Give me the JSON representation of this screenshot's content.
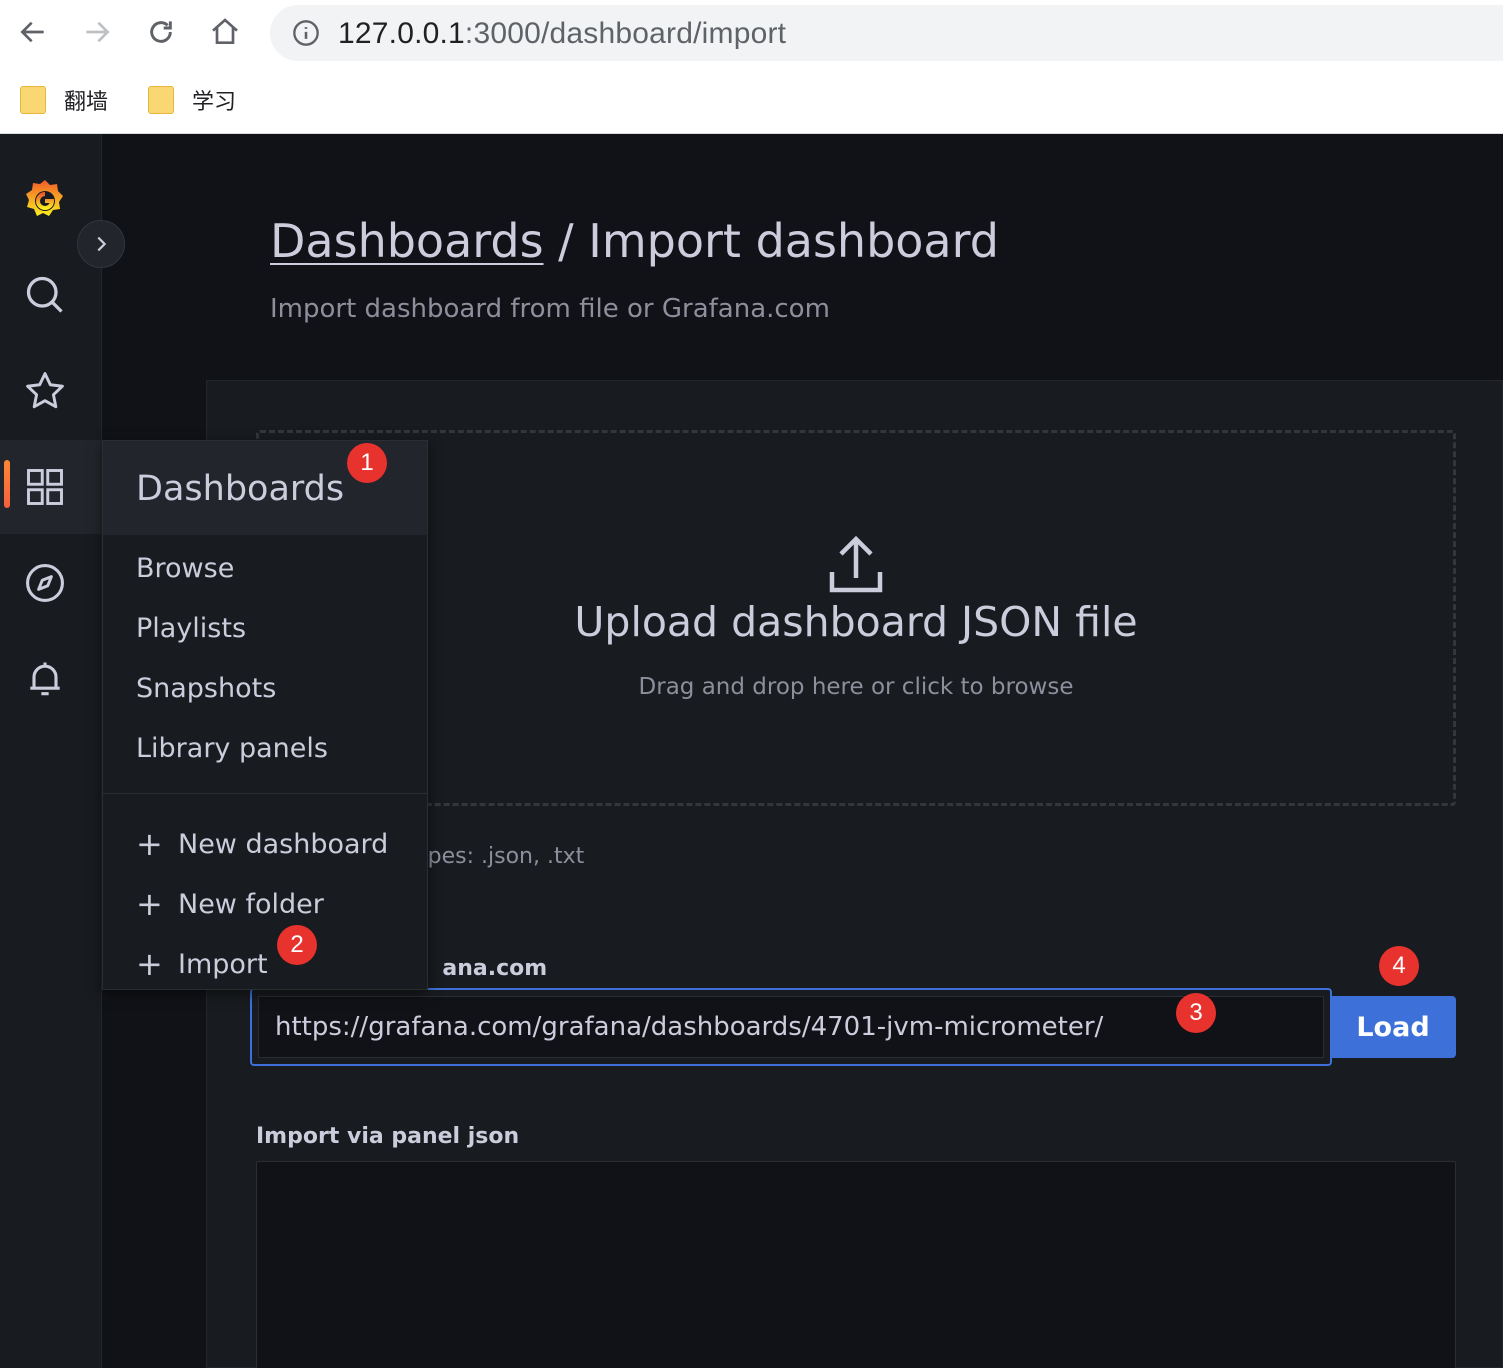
{
  "browser": {
    "url_host": "127.0.0.1",
    "url_path": ":3000/dashboard/import",
    "bookmarks": [
      {
        "label": "翻墙",
        "icon": "folder-icon"
      },
      {
        "label": "学习",
        "icon": "folder-icon"
      }
    ]
  },
  "page": {
    "breadcrumb": "Dashboards",
    "separator": " / ",
    "title": "Import dashboard",
    "subtitle": "Import dashboard from file or Grafana.com"
  },
  "upload": {
    "title": "Upload dashboard JSON file",
    "subtitle": "Drag and drop here or click to browse",
    "file_types_visible": "ypes: .json, .txt"
  },
  "grafana_com": {
    "label_visible": "ana.com",
    "value": "https://grafana.com/grafana/dashboards/4701-jvm-micrometer/",
    "load_label": "Load"
  },
  "panel_json": {
    "label": "Import via panel json"
  },
  "menu": {
    "header": "Dashboards",
    "items": [
      "Browse",
      "Playlists",
      "Snapshots",
      "Library panels"
    ],
    "actions": [
      "New dashboard",
      "New folder",
      "Import"
    ]
  },
  "badges": [
    "1",
    "2",
    "3",
    "4"
  ],
  "colors": {
    "accent": "#3d71d9",
    "badge": "#e8322e",
    "active_bar": "#ff8833"
  }
}
